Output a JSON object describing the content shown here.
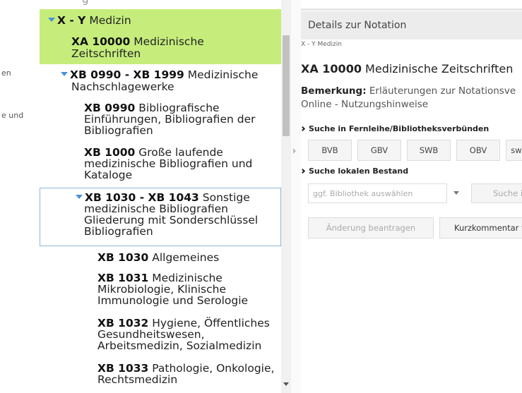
{
  "left_fragments": [
    "en",
    "e und"
  ],
  "tree": {
    "top_partial": "g",
    "items": [
      {
        "code": "X - Y",
        "title": "Medizin"
      },
      {
        "code": "XA 10000",
        "title": "Medizinische",
        "title2": "Zeitschriften"
      },
      {
        "code": "XB 0990 - XB 1999",
        "title": "Medizinische",
        "title2": "Nachschlagewerke"
      },
      {
        "code": "XB 0990",
        "title": "Bibliografische",
        "title2": "Einführungen, Bibliografien der",
        "title3": "Bibliografien"
      },
      {
        "code": "XB 1000",
        "title": "Große laufende",
        "title2": "medizinische Bibliografien und",
        "title3": "Kataloge"
      },
      {
        "code": "XB 1030 - XB 1043",
        "title": "Sonstige",
        "title2": "medizinische Bibliografien",
        "title3": "Gliederung mit Sonderschlüssel",
        "title4": "Bibliografien"
      },
      {
        "code": "XB 1030",
        "title": "Allgemeines"
      },
      {
        "code": "XB 1031",
        "title": "Medizinische",
        "title2": "Mikrobiologie, Klinische",
        "title3": "Immunologie und Serologie"
      },
      {
        "code": "XB 1032",
        "title": "Hygiene, Öffentliches",
        "title2": "Gesundheitswesen,",
        "title3": "Arbeitsmedizin, Sozialmedizin"
      },
      {
        "code": "XB 1033",
        "title": "Pathologie, Onkologie,",
        "title2": "Rechtsmedizin"
      }
    ]
  },
  "detail": {
    "header": "Details zur Notation",
    "breadcrumb": "X - Y Medizin",
    "notation_code": "XA 10000",
    "notation_title": "Medizinische Zeitschriften",
    "remark_label": "Bemerkung:",
    "remark_text": "Erläuterungen zur Notationsve",
    "remark_line2": "Online - Nutzungshinweise",
    "section_fernleihe": "Suche in Fernleihe/Bibliotheksverbünden",
    "verbund_buttons": [
      "BVB",
      "GBV",
      "SWB",
      "OBV",
      "sw"
    ],
    "section_lokal": "Suche lokalen Bestand",
    "library_placeholder": "ggf. Bibliothek auswählen",
    "search_button": "Suche in",
    "change_button": "Änderung beantragen",
    "comment_button": "Kurzkommentar ve"
  },
  "colors": {
    "highlight": "#c6ed7c",
    "triangle": "#4a90d9",
    "selected_border": "#8fb7d8"
  }
}
